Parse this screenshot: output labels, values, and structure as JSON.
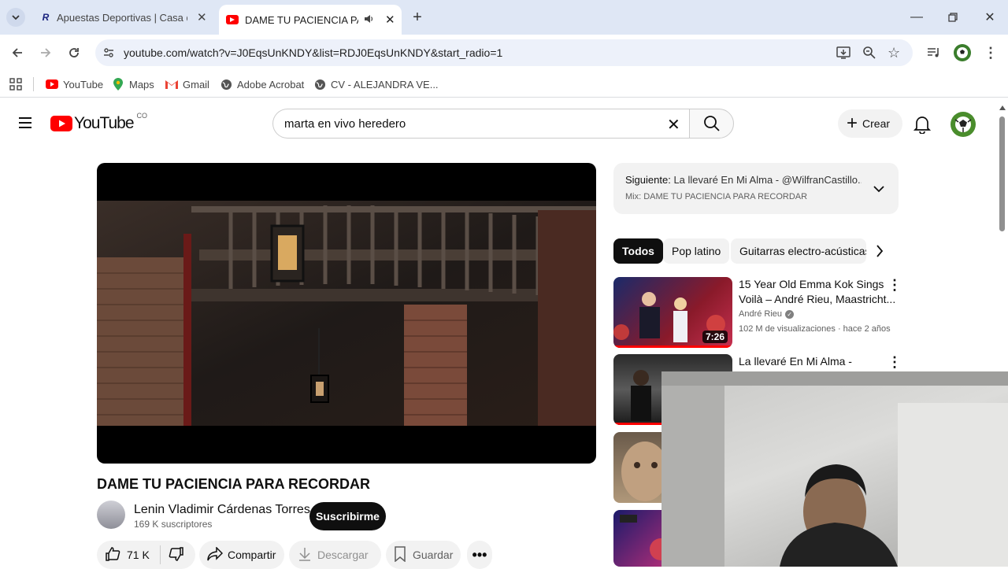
{
  "browser": {
    "tabs": [
      {
        "title": "Apuestas Deportivas | Casa de Apuestas"
      },
      {
        "title": "DAME TU PACIENCIA PARA RECORDAR"
      }
    ],
    "url": "youtube.com/watch?v=J0EqsUnKNDY&list=RDJ0EqsUnKNDY&start_radio=1",
    "bookmarks": [
      {
        "label": "YouTube",
        "icon": "youtube-icon"
      },
      {
        "label": "Maps",
        "icon": "maps-icon"
      },
      {
        "label": "Gmail",
        "icon": "gmail-icon"
      },
      {
        "label": "Adobe Acrobat",
        "icon": "globe-icon"
      },
      {
        "label": "CV - ALEJANDRA VE..."
      }
    ]
  },
  "youtube": {
    "logo": "YouTube",
    "country": "CO",
    "search_value": "marta en vivo heredero",
    "create_label": "Crear"
  },
  "video": {
    "title": "DAME TU PACIENCIA PARA RECORDAR",
    "channel": "Lenin Vladimir Cárdenas Torres",
    "subscribers": "169 K suscriptores",
    "subscribe_label": "Suscribirme",
    "likes": "71 K",
    "share_label": "Compartir",
    "download_label": "Descargar",
    "save_label": "Guardar"
  },
  "playlist": {
    "next_prefix": "Siguiente:",
    "next_title": "La llevaré En Mi Alma - @WilfranCastillo...",
    "mix_title": "Mix: DAME TU PACIENCIA PARA RECORDAR"
  },
  "chips": [
    "Todos",
    "Pop latino",
    "Guitarras electro-acústicas"
  ],
  "recommendations": [
    {
      "title_line1": "15 Year Old Emma Kok Sings",
      "title_line2": "Voilà – André Rieu, Maastricht...",
      "channel": "André Rieu",
      "meta": "102 M de visualizaciones · hace 2 años",
      "duration": "7:26"
    },
    {
      "title_line1": "La llevaré En Mi Alma -"
    }
  ]
}
